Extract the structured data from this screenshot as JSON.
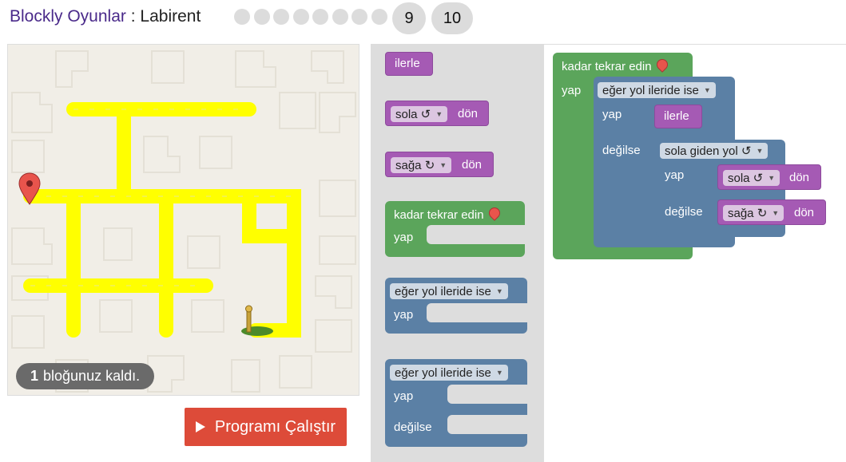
{
  "header": {
    "app_name": "Blockly Oyunlar",
    "separator": " : ",
    "game_name": "Labirent",
    "level_dots_count": 8,
    "level_9": "9",
    "level_10": "10"
  },
  "maze": {
    "capacity_count": "1",
    "capacity_text": "bloğunuz kaldı."
  },
  "run_button": {
    "label": "Programı Çalıştır",
    "icon": "play-icon"
  },
  "toolbox": {
    "forward": "ilerle",
    "turn_left": {
      "dropdown": "sola ↺",
      "suffix": "dön"
    },
    "turn_right": {
      "dropdown": "sağa ↻",
      "suffix": "dön"
    },
    "repeat": {
      "label": "kadar tekrar edin",
      "do": "yap",
      "icon": "marker-icon"
    },
    "if": {
      "dropdown": "eğer yol ileride ise",
      "do": "yap"
    },
    "ifelse": {
      "dropdown": "eğer yol ileride ise",
      "do": "yap",
      "else": "değilse"
    }
  },
  "workspace": {
    "repeat_label": "kadar tekrar edin",
    "repeat_do": "yap",
    "if_dropdown": "eğer yol ileride ise",
    "if_do": "yap",
    "forward": "ilerle",
    "if_else": "değilse",
    "inner_dropdown": "sola giden yol ↺",
    "inner_do": "yap",
    "inner_turn_left": "sola ↺",
    "inner_turn_left_suffix": "dön",
    "inner_else": "değilse",
    "inner_turn_right": "sağa ↻",
    "inner_turn_right_suffix": "dön"
  },
  "colors": {
    "logic_block": "#5b80a5",
    "loop_block": "#5ba55b",
    "movement_block": "#a55ab4",
    "run_button": "#dd4b39",
    "path": "#ffff00"
  }
}
